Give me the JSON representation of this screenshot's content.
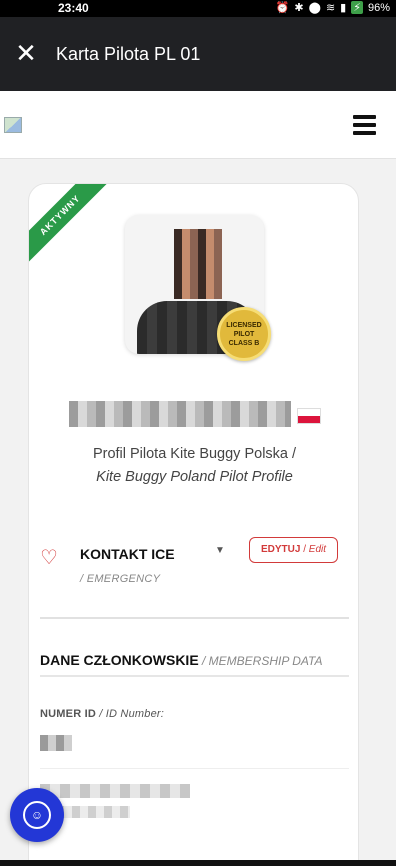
{
  "status": {
    "time": "23:40",
    "battery": "96%"
  },
  "appbar": {
    "title": "Karta Pilota PL 01"
  },
  "card": {
    "ribbon": "AKTYWNY",
    "badge": {
      "line1": "LICENSED",
      "line2": "PILOT",
      "line3": "CLASS B"
    },
    "profile_pl": "Profil Pilota Kite Buggy Polska /",
    "profile_en": "Kite Buggy Poland Pilot Profile",
    "ice": {
      "label": "KONTAKT ICE",
      "sub": "/ EMERGENCY",
      "arrow": "▼",
      "edit_main": "EDYTUJ",
      "edit_sep": " / ",
      "edit_sub": "Edit"
    },
    "membership": {
      "title": "DANE CZŁONKOWSKIE",
      "title_sub": " / MEMBERSHIP DATA",
      "id_label": "NUMER ID",
      "id_label_sub": " / ID Number:"
    }
  },
  "icons": {
    "close": "close-icon",
    "menu": "hamburger-menu-icon",
    "heart": "heart-icon",
    "accessibility": "accessibility-icon"
  },
  "colors": {
    "appbar": "#202124",
    "ribbon": "#2a9a48",
    "accent_red": "#d23a3a",
    "fab_blue": "#2337d6"
  }
}
